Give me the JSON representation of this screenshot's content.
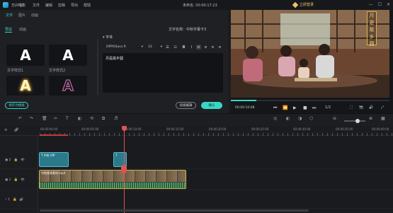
{
  "app": {
    "name": "万兴喵影",
    "doc_title": "未命名: 00:00:17:23",
    "login_label": "立即登录"
  },
  "menu": [
    "文件",
    "编辑",
    "剪辑",
    "导出",
    "帮助"
  ],
  "window_controls": [
    "—",
    "☐",
    "✕"
  ],
  "left_tabs": [
    "文字",
    "图片",
    "动画"
  ],
  "sub_tabs": [
    "预设",
    "动画"
  ],
  "presets": [
    {
      "glyph": "A",
      "label": "文字样式1",
      "color": "#ffffff",
      "glow": "none"
    },
    {
      "glyph": "A",
      "label": "文字样式2",
      "color": "#ffffff",
      "glow": "none"
    },
    {
      "glyph": "A",
      "label": "",
      "color": "#fff7c2",
      "glow": "gold"
    },
    {
      "glyph": "A",
      "label": "",
      "color": "#1b1c20",
      "glow": "pink"
    }
  ],
  "save_preset_label": "保存为模板",
  "text_panel": {
    "title": "文字名称：中秋字幕卡3",
    "section": "▾ 字体",
    "font": "OPPOSans R",
    "size": "33",
    "format_buttons": [
      "☰",
      "☷",
      "B",
      "I",
      "≡",
      "≡",
      "≡",
      "≡"
    ],
    "content": "月是故乡圆",
    "advanced_label": "高级编辑",
    "ok_label": "确认"
  },
  "preview": {
    "overlay_text": [
      "月",
      "是",
      "故",
      "乡",
      "圆"
    ],
    "current_time": "00:00:10:08",
    "ratio": "1/2",
    "controls": [
      "⏮",
      "⏪",
      "▶",
      "■",
      "⏭"
    ],
    "right_controls": [
      "⛶",
      "📷",
      "🔊",
      "⤢"
    ]
  },
  "toolbar": [
    "↶",
    "↷",
    "🗑",
    "✂",
    "T",
    "◐",
    "⟲",
    "⧉",
    "♬"
  ],
  "toolbar_right": [
    "◎",
    "◐",
    "◑",
    "⬡",
    "⊖",
    "⊕",
    "▦"
  ],
  "ruler": {
    "labels": [
      "00:00:00:00",
      "00:00:05:00",
      "00:00:10:00",
      "00:00:15:00",
      "00:00:20:00",
      "00:00:25:00",
      "00:00:30:00",
      "00:00:35:00",
      "00:00:40:00"
    ]
  },
  "tracks": [
    {
      "name": "▣ 2",
      "icons": [
        "🔒",
        "👁"
      ]
    },
    {
      "name": "▣ 1",
      "icons": [
        "🔒",
        "👁"
      ]
    },
    {
      "name": "♪ 1",
      "icons": [
        "🔒",
        "🔊"
      ]
    }
  ],
  "clips": {
    "text_a": "T 中秋 VIP",
    "text_b": "T",
    "video": "中秋视频素材.mp4"
  }
}
